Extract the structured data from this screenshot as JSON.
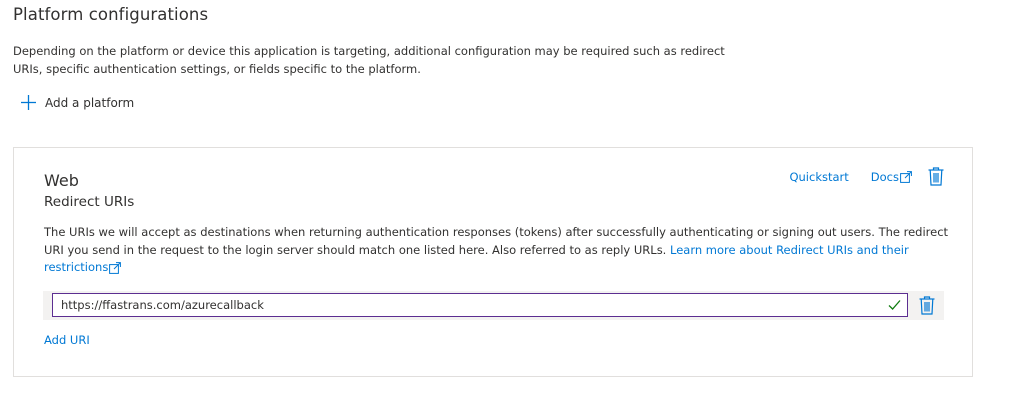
{
  "header": {
    "title": "Platform configurations",
    "description": "Depending on the platform or device this application is targeting, additional configuration may be required such as redirect URIs, specific authentication settings, or fields specific to the platform.",
    "add_platform_label": "Add a platform"
  },
  "web_card": {
    "title": "Web",
    "subtitle": "Redirect URIs",
    "quickstart_label": "Quickstart",
    "docs_label": "Docs",
    "description": "The URIs we will accept as destinations when returning authentication responses (tokens) after successfully authenticating or signing out users. The redirect URI you send in the request to the login server should match one listed here. Also referred to as reply URLs.",
    "learn_more_label": "Learn more about Redirect URIs and their restrictions",
    "redirect_uris": [
      {
        "value": "https://ffastrans.com/azurecallback",
        "valid": true
      }
    ],
    "add_uri_label": "Add URI"
  },
  "colors": {
    "link": "#0078d4",
    "text": "#323130",
    "input_border_focus": "#5c2e91",
    "valid_check": "#107c10",
    "card_border": "#e1dfdd",
    "row_background": "#f3f2f1"
  },
  "icons": {
    "add": "plus-icon",
    "delete": "trash-icon",
    "external": "external-link-icon",
    "valid": "checkmark-icon"
  }
}
